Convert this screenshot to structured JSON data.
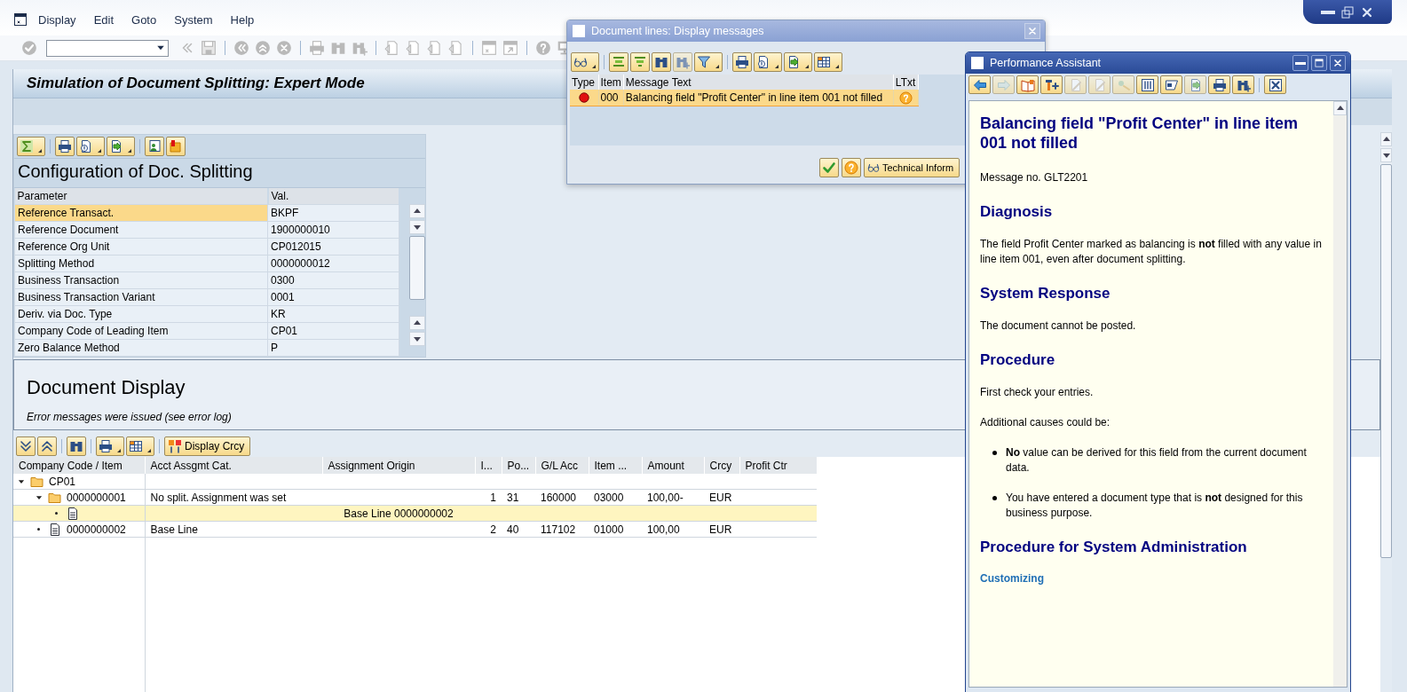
{
  "menu": [
    {
      "label": "Display"
    },
    {
      "label": "Edit"
    },
    {
      "label": "Goto"
    },
    {
      "label": "System"
    },
    {
      "label": "Help"
    }
  ],
  "title": "Simulation of Document Splitting: Expert Mode",
  "config": {
    "title": "Configuration of Doc. Splitting",
    "columns": [
      "Parameter",
      "Val."
    ],
    "rows": [
      {
        "parameter": "Reference Transact.",
        "value": "BKPF",
        "selected": true
      },
      {
        "parameter": "Reference Document",
        "value": "1900000010",
        "selected": false
      },
      {
        "parameter": "Reference Org Unit",
        "value": "CP012015",
        "selected": false
      },
      {
        "parameter": "Splitting Method",
        "value": "0000000012",
        "selected": false
      },
      {
        "parameter": "Business Transaction",
        "value": "0300",
        "selected": false
      },
      {
        "parameter": "Business Transaction Variant",
        "value": "0001",
        "selected": false
      },
      {
        "parameter": "Deriv. via Doc. Type",
        "value": "KR",
        "selected": false
      },
      {
        "parameter": "Company Code of Leading Item",
        "value": "CP01",
        "selected": false
      },
      {
        "parameter": "Zero Balance Method",
        "value": "P",
        "selected": false
      }
    ]
  },
  "document_display": {
    "title": "Document Display",
    "message": "Error messages were issued (see error log)",
    "currency_button": "Display Crcy",
    "columns": [
      "Company Code / Item",
      "Acct Assgmt Cat.",
      "Assignment Origin",
      "I...",
      "Po...",
      "G/L Acc",
      "Item ...",
      "Amount",
      "Crcy",
      "Profit Ctr"
    ],
    "rows": [
      {
        "kind": "folder",
        "label": "CP01",
        "expanded": true,
        "selected": false,
        "children": [
          {
            "kind": "folder",
            "label": "0000000001",
            "expanded": true,
            "selected": false,
            "cells": [
              "No split. Assignment was set",
              null,
              "1",
              "31",
              "160000",
              "03000",
              "100,00-",
              "EUR",
              null
            ],
            "children": [
              {
                "kind": "document",
                "expanded": false,
                "selected": true,
                "cells": [
                  null,
                  "Base Line 0000000002",
                  null,
                  null,
                  null,
                  null,
                  null,
                  null,
                  null
                ]
              }
            ]
          },
          {
            "kind": "document",
            "label": "0000000002",
            "expanded": false,
            "selected": false,
            "cells": [
              "Base Line",
              null,
              "2",
              "40",
              "117102",
              "01000",
              "100,00",
              "EUR",
              null
            ]
          }
        ]
      }
    ]
  },
  "messages_dialog": {
    "title": "Document lines: Display messages",
    "columns": [
      "Type",
      "Item",
      "Message Text",
      "LTxt"
    ],
    "rows": [
      {
        "kind": "error",
        "item": "000",
        "text": "Balancing field \"Profit Center\" in line item 001 not filled",
        "long_text": true,
        "selected": true
      }
    ],
    "technical_button": "Technical Inform"
  },
  "assistant": {
    "title": "Performance Assistant",
    "content": [
      {
        "kind": "title",
        "text": "Balancing field \"Profit Center\" in line item 001 not filled"
      },
      {
        "kind": "paragraph",
        "text": "Message no. GLT2201"
      },
      {
        "kind": "heading",
        "text": "Diagnosis"
      },
      {
        "kind": "paragraph",
        "text": "The field Profit Center marked as balancing is **not** filled with any value in line item 001, even after document splitting."
      },
      {
        "kind": "heading",
        "text": "System Response"
      },
      {
        "kind": "paragraph",
        "text": "The document cannot be posted."
      },
      {
        "kind": "heading",
        "text": "Procedure"
      },
      {
        "kind": "paragraph",
        "text": "First check your entries."
      },
      {
        "kind": "paragraph",
        "text": "Additional causes could be:"
      },
      {
        "kind": "bullet",
        "text": "**No** value can be derived for this field from the current document data."
      },
      {
        "kind": "bullet",
        "text": "You have entered a document type that is **not** designed for this business purpose."
      },
      {
        "kind": "heading",
        "text": "Procedure for System Administration"
      },
      {
        "kind": "link",
        "text": "Customizing"
      }
    ]
  }
}
